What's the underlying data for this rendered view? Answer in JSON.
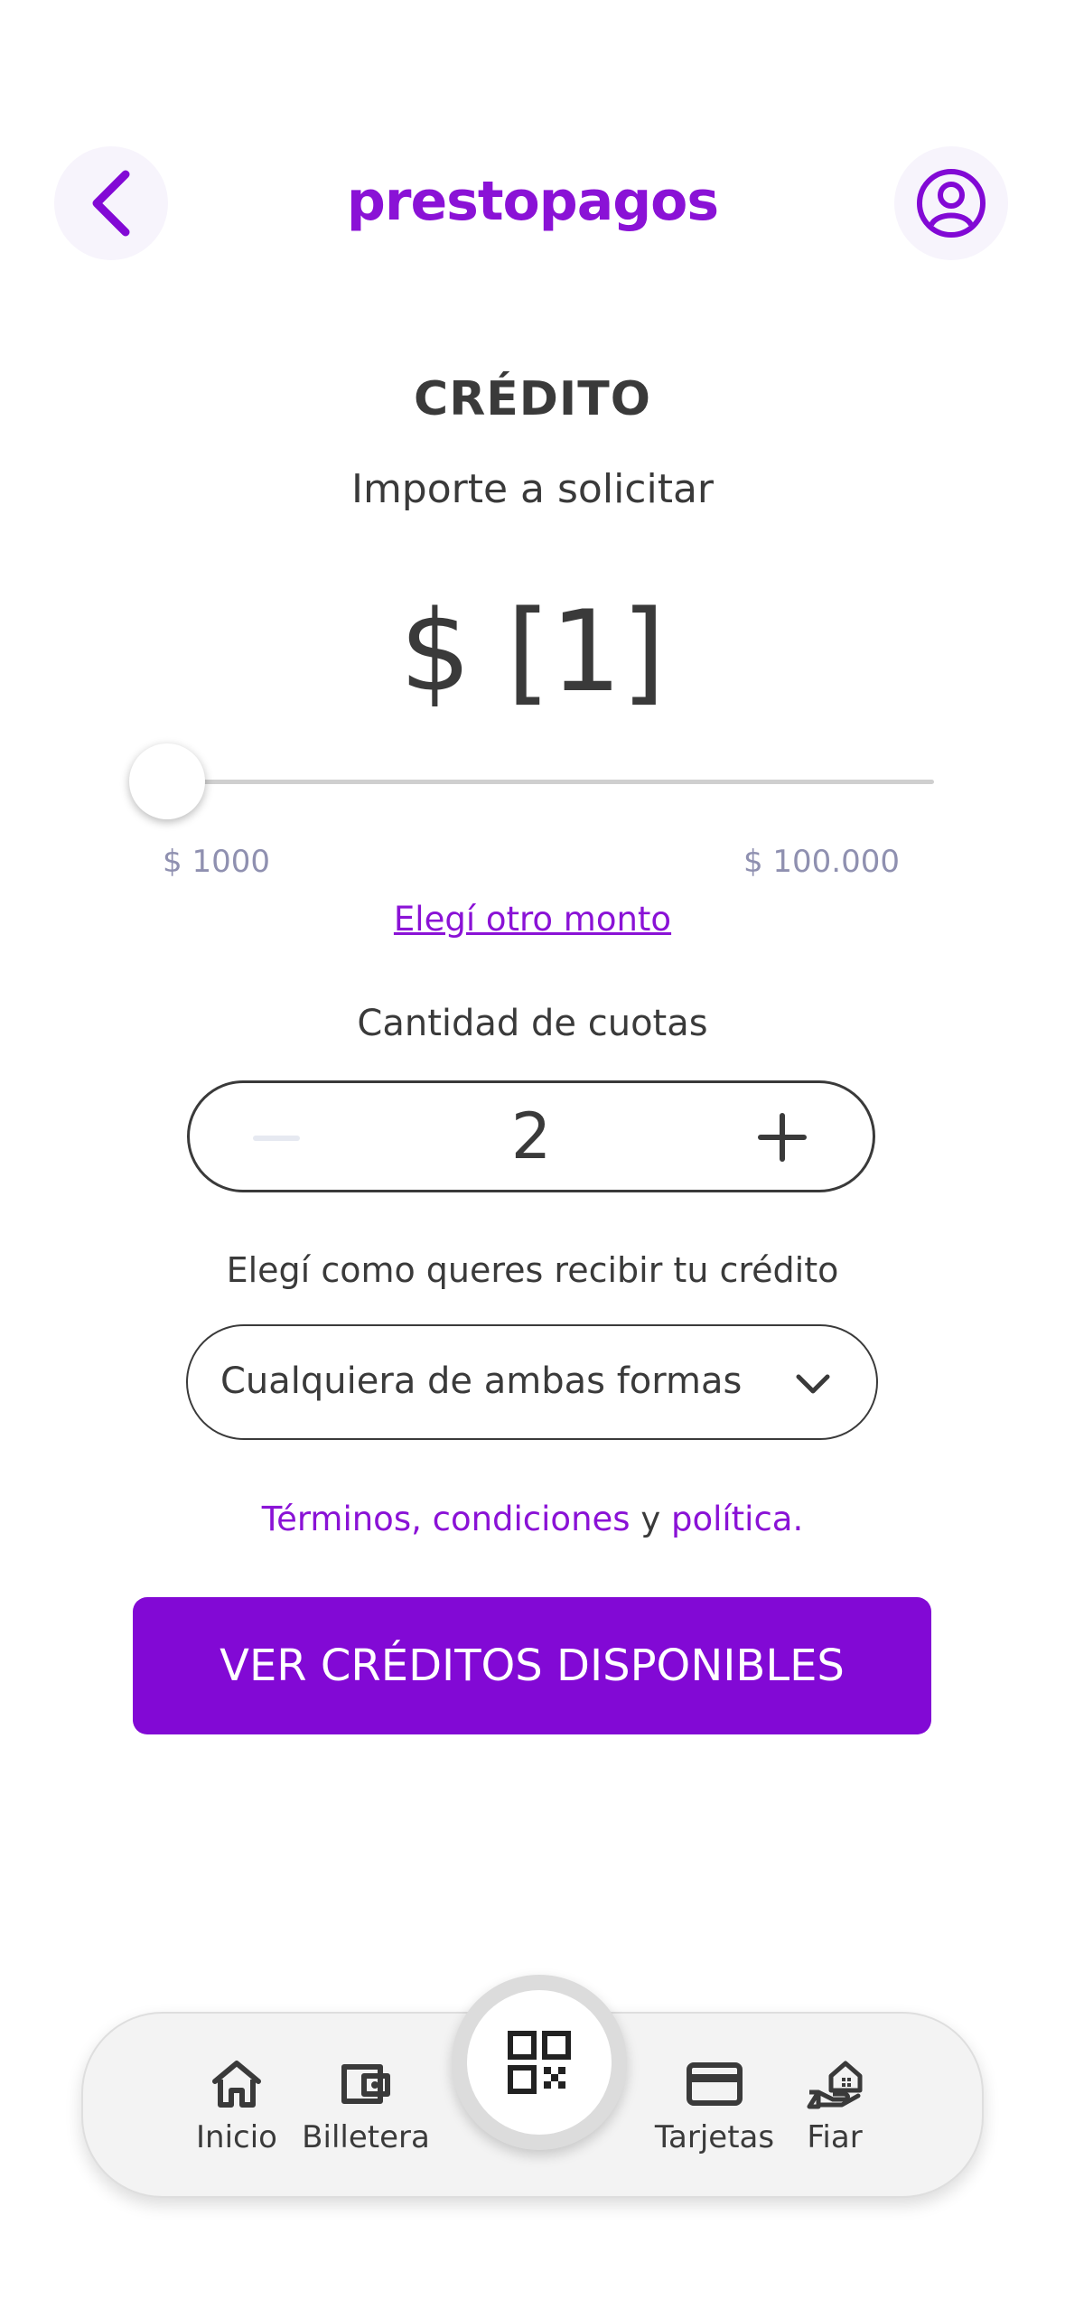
{
  "header": {
    "logo_part1": "presto",
    "logo_part2": "pagos",
    "back_icon": "chevron-left-icon",
    "profile_icon": "user-circle-icon"
  },
  "credit": {
    "title": "CRÉDITO",
    "subtitle": "Importe a solicitar",
    "amount": "$ [1]",
    "slider_min_label": "$ 1000",
    "slider_max_label": "$ 100.000",
    "slider_position": 0,
    "other_amount_link": "Elegí otro monto"
  },
  "cuotas": {
    "label": "Cantidad de cuotas",
    "value": "2"
  },
  "recibir": {
    "label": "Elegí como queres recibir tu crédito",
    "selected": "Cualquiera de ambas formas"
  },
  "terms": {
    "link1": "Términos, condiciones",
    "connector": " y ",
    "link2": "política."
  },
  "cta": {
    "label": "VER CRÉDITOS DISPONIBLES"
  },
  "bottom_nav": {
    "items": [
      {
        "label": "Inicio",
        "icon": "home-icon"
      },
      {
        "label": "Billetera",
        "icon": "wallet-icon"
      },
      {
        "label": "Tarjetas",
        "icon": "credit-card-icon"
      },
      {
        "label": "Fiar",
        "icon": "hand-house-icon"
      }
    ],
    "center_icon": "qr-code-icon"
  },
  "colors": {
    "accent": "#8209d5",
    "text": "#3a3a3a",
    "muted": "#8f90b0"
  }
}
